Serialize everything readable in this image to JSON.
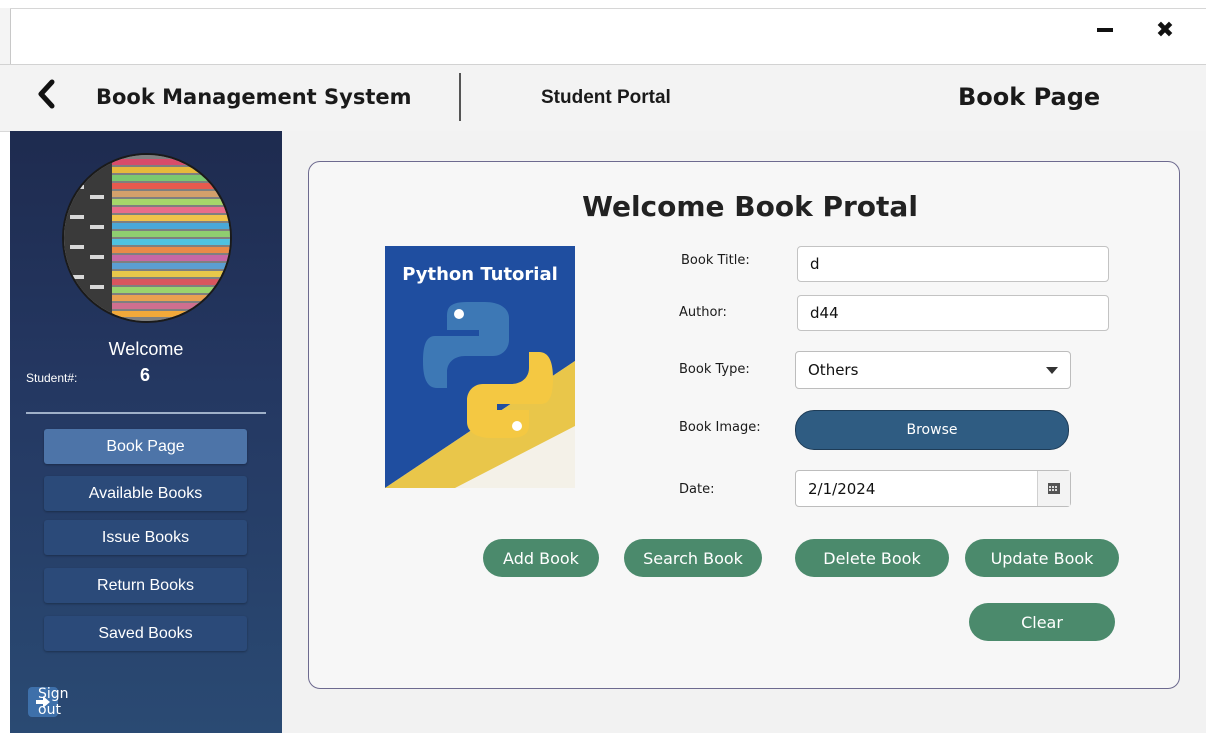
{
  "window": {
    "minimize_icon": "minimize-icon",
    "close_label": "✖"
  },
  "header": {
    "app_title": "Book Management System",
    "portal": "Student Portal",
    "page_title": "Book Page"
  },
  "sidebar": {
    "welcome": "Welcome",
    "student_label": "Student#:",
    "student_number": "6",
    "items": [
      {
        "label": "Book Page",
        "active": true
      },
      {
        "label": "Available Books"
      },
      {
        "label": "Issue Books"
      },
      {
        "label": "Return Books"
      },
      {
        "label": "Saved Books"
      }
    ],
    "signout_label": "Sign out"
  },
  "form": {
    "title": "Welcome Book Protal",
    "image_caption": "Python Tutorial",
    "book_title_label": "Book Title:",
    "book_title_value": "d",
    "author_label": "Author:",
    "author_value": "d44",
    "book_type_label": "Book Type:",
    "book_type_value": "Others",
    "book_image_label": "Book Image:",
    "browse_label": "Browse",
    "date_label": "Date:",
    "date_value": "2/1/2024"
  },
  "actions": {
    "add": "Add Book",
    "search": "Search Book",
    "delete": "Delete Book",
    "update": "Update Book",
    "clear": "Clear"
  },
  "colors": {
    "sidebar": "#243761",
    "nav_active": "#4d74a8",
    "browse": "#2f5c82",
    "action_green": "#4b8a6c"
  }
}
